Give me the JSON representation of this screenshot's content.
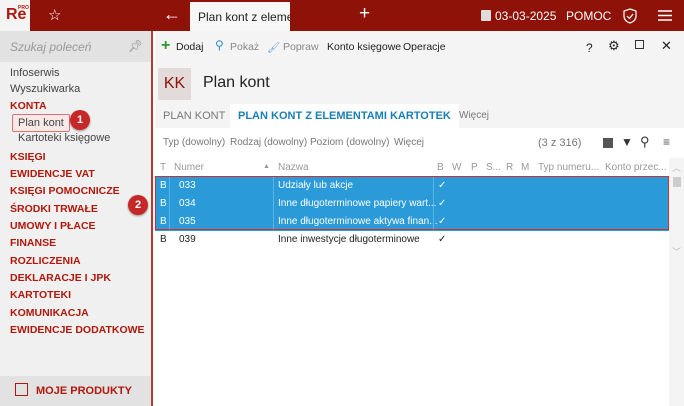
{
  "topbar": {
    "logo": "Re",
    "logo_sup": "PRO",
    "tab": "Plan kont z elementami kartotek",
    "date": "03-03-2025",
    "help": "POMOC"
  },
  "sidebar": {
    "search_placeholder": "Szukaj poleceń",
    "items": [
      {
        "label": "Infoserwis"
      },
      {
        "label": "Wyszukiwarka"
      },
      {
        "label": "KONTA"
      },
      {
        "label": "Plan kont"
      },
      {
        "label": "Kartoteki księgowe"
      },
      {
        "label": "KSIĘGI"
      },
      {
        "label": "EWIDENCJE VAT"
      },
      {
        "label": "KSIĘGI POMOCNICZE"
      },
      {
        "label": "ŚRODKI TRWAŁE"
      },
      {
        "label": "UMOWY I PŁACE"
      },
      {
        "label": "FINANSE"
      },
      {
        "label": "ROZLICZENIA"
      },
      {
        "label": "DEKLARACJE I JPK"
      },
      {
        "label": "KARTOTEKI"
      },
      {
        "label": "KOMUNIKACJA"
      },
      {
        "label": "EWIDENCJE DODATKOWE"
      }
    ],
    "bottom": "MOJE PRODUKTY"
  },
  "toolbar": {
    "add": "Dodaj",
    "show": "Pokaż",
    "edit": "Popraw",
    "account": "Konto księgowe",
    "operations": "Operacje",
    "help": "?"
  },
  "header": {
    "badge": "KK",
    "title": "Plan kont"
  },
  "tabs": [
    "PLAN KONT",
    "PLAN KONT Z ELEMENTAMI KARTOTEK",
    "Więcej"
  ],
  "filters": [
    "Typ (dowolny)",
    "Rodzaj (dowolny)",
    "Poziom (dowolny)",
    "Więcej"
  ],
  "count": "(3 z 316)",
  "columns": [
    "T",
    "Numer",
    "Nazwa",
    "B",
    "W",
    "P",
    "S...",
    "R",
    "M",
    "Typ numeru...",
    "Konto przec..."
  ],
  "rows": [
    {
      "t": "B",
      "num": "033",
      "name": "Udziały lub akcje",
      "b": "✓",
      "selected": true
    },
    {
      "t": "B",
      "num": "034",
      "name": "Inne długoterminowe papiery wart...",
      "b": "✓",
      "selected": true
    },
    {
      "t": "B",
      "num": "035",
      "name": "Inne długoterminowe aktywa finan...",
      "b": "✓",
      "selected": true
    },
    {
      "t": "B",
      "num": "039",
      "name": "Inne inwestycje długoterminowe",
      "b": "✓",
      "selected": false
    }
  ],
  "callouts": [
    "1",
    "2"
  ],
  "colors": {
    "brand": "#8e1208",
    "selection": "#2a9ad8",
    "accent": "#1a7fb5"
  }
}
